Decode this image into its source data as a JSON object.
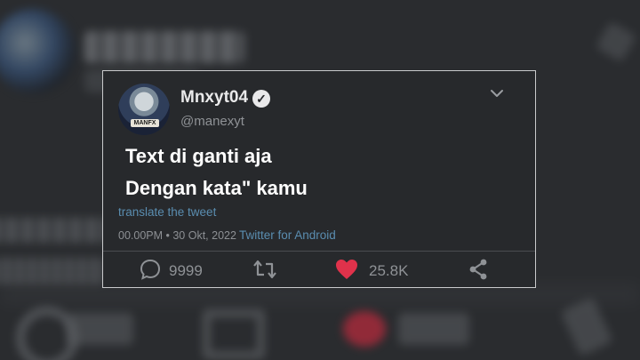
{
  "tweet": {
    "display_name": "Mnxyt04",
    "handle": "@manexyt",
    "avatar_tag": "MANFX",
    "text_lines": [
      "Text di ganti aja",
      "Dengan kata\" kamu"
    ],
    "translate_label": "translate the tweet",
    "timestamp": "00.00PM • 30 Okt, 2022",
    "source": "Twitter for Android"
  },
  "actions": {
    "replies": "9999",
    "likes": "25.8K"
  },
  "icons": {
    "verified": "verified-badge-icon",
    "menu": "chevron-down-icon",
    "reply": "comment-icon",
    "retweet": "retweet-icon",
    "like": "heart-icon",
    "share": "share-icon"
  },
  "colors": {
    "background": "#2a2c2f",
    "card": "#27292c",
    "link": "#5a8db0",
    "heart": "#e0324b"
  }
}
